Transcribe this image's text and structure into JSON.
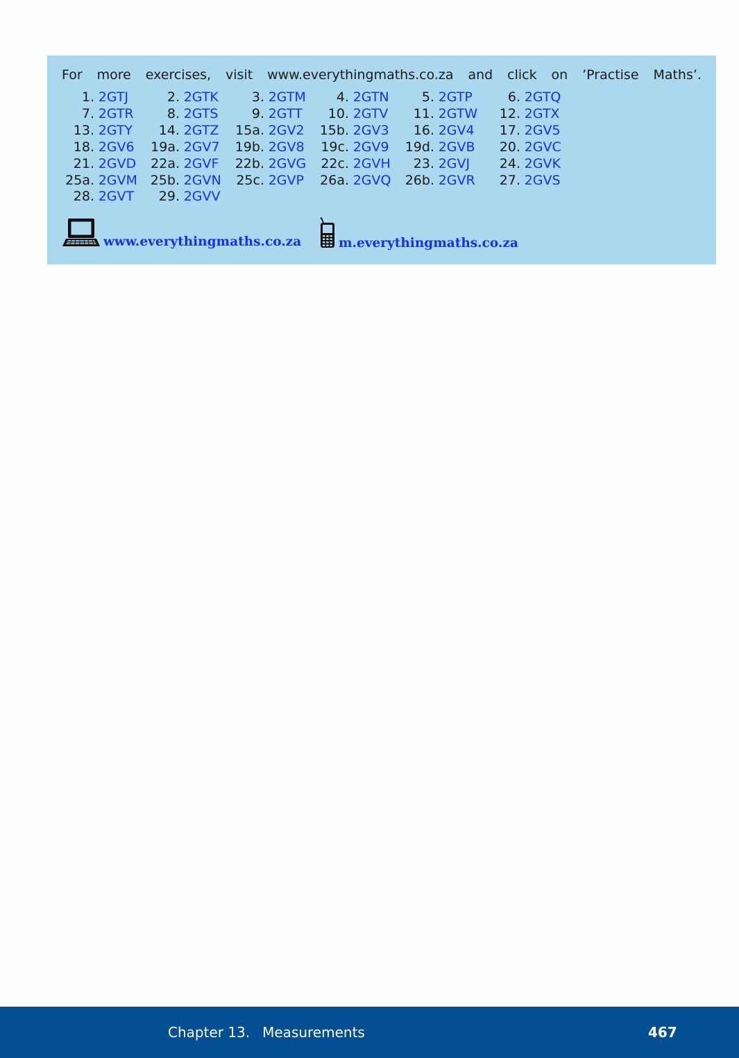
{
  "intro_words": [
    "For",
    "more",
    "exercises,",
    "visit",
    "www.everythingmaths.co.za",
    "and",
    "click",
    "on",
    "’Practise",
    "Maths’."
  ],
  "codes": [
    {
      "num": "1.",
      "code": "2GTJ"
    },
    {
      "num": "2.",
      "code": "2GTK"
    },
    {
      "num": "3.",
      "code": "2GTM"
    },
    {
      "num": "4.",
      "code": "2GTN"
    },
    {
      "num": "5.",
      "code": "2GTP"
    },
    {
      "num": "6.",
      "code": "2GTQ"
    },
    {
      "num": "7.",
      "code": "2GTR"
    },
    {
      "num": "8.",
      "code": "2GTS"
    },
    {
      "num": "9.",
      "code": "2GTT"
    },
    {
      "num": "10.",
      "code": "2GTV"
    },
    {
      "num": "11.",
      "code": "2GTW"
    },
    {
      "num": "12.",
      "code": "2GTX"
    },
    {
      "num": "13.",
      "code": "2GTY"
    },
    {
      "num": "14.",
      "code": "2GTZ"
    },
    {
      "num": "15a.",
      "code": "2GV2"
    },
    {
      "num": "15b.",
      "code": "2GV3"
    },
    {
      "num": "16.",
      "code": "2GV4"
    },
    {
      "num": "17.",
      "code": "2GV5"
    },
    {
      "num": "18.",
      "code": "2GV6"
    },
    {
      "num": "19a.",
      "code": "2GV7"
    },
    {
      "num": "19b.",
      "code": "2GV8"
    },
    {
      "num": "19c.",
      "code": "2GV9"
    },
    {
      "num": "19d.",
      "code": "2GVB"
    },
    {
      "num": "20.",
      "code": "2GVC"
    },
    {
      "num": "21.",
      "code": "2GVD"
    },
    {
      "num": "22a.",
      "code": "2GVF"
    },
    {
      "num": "22b.",
      "code": "2GVG"
    },
    {
      "num": "22c.",
      "code": "2GVH"
    },
    {
      "num": "23.",
      "code": "2GVJ"
    },
    {
      "num": "24.",
      "code": "2GVK"
    },
    {
      "num": "25a.",
      "code": "2GVM"
    },
    {
      "num": "25b.",
      "code": "2GVN"
    },
    {
      "num": "25c.",
      "code": "2GVP"
    },
    {
      "num": "26a.",
      "code": "2GVQ"
    },
    {
      "num": "26b.",
      "code": "2GVR"
    },
    {
      "num": "27.",
      "code": "2GVS"
    },
    {
      "num": "28.",
      "code": "2GVT"
    },
    {
      "num": "29.",
      "code": "2GVV"
    }
  ],
  "links": {
    "desktop": "www.everythingmaths.co.za",
    "mobile": "m.everythingmaths.co.za",
    "desktop_icon": "laptop-icon",
    "mobile_icon": "mobile-phone-icon"
  },
  "footer": {
    "chapter_label": "Chapter 13.",
    "chapter_title": "Measurements",
    "page_number": "467"
  },
  "colors": {
    "box_background": "#acd8ef",
    "link_blue": "#1a2fe8",
    "footer_background": "#044f94"
  }
}
